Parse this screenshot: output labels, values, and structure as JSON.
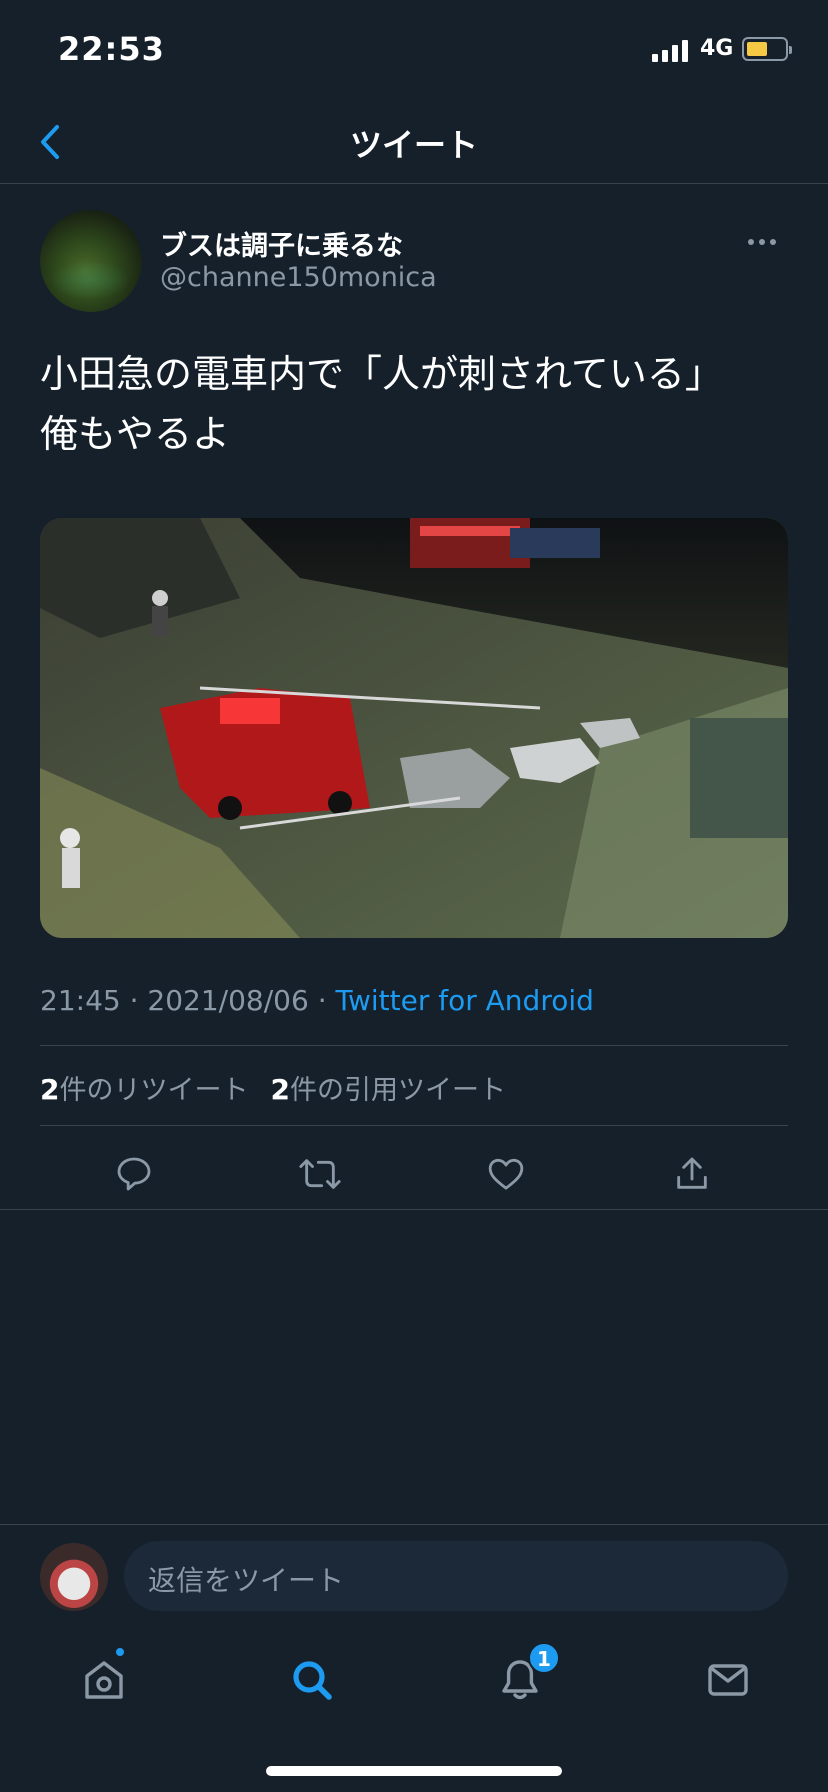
{
  "status_bar": {
    "time": "22:53",
    "network": "4G",
    "battery_color": "#f6c945"
  },
  "navbar": {
    "title": "ツイート",
    "back_icon": "chevron-left-icon"
  },
  "tweet": {
    "display_name": "ブスは調子に乗るな",
    "handle": "@channe150monica",
    "more_icon": "more-horizontal-icon",
    "text_lines": [
      "小田急の電車内で「人が刺されている」",
      "俺もやるよ"
    ],
    "media_description": "",
    "meta": {
      "time": "21:45",
      "separator": " · ",
      "date": "2021/08/06",
      "source": "Twitter for Android"
    },
    "counts": {
      "retweets_number": "2",
      "retweets_label": "件のリツイート",
      "quotes_number": "2",
      "quotes_label": "件の引用ツイート"
    },
    "actions": [
      "reply-icon",
      "retweet-icon",
      "like-icon",
      "share-icon"
    ]
  },
  "reply": {
    "placeholder": "返信をツイート"
  },
  "tabbar": {
    "items": [
      "home-icon",
      "search-icon",
      "notifications-icon",
      "messages-icon"
    ],
    "notification_badge": "1"
  },
  "colors": {
    "background": "#15202b",
    "accent": "#1d9bf0",
    "secondary_text": "#8b98a5",
    "divider": "#38444d"
  }
}
